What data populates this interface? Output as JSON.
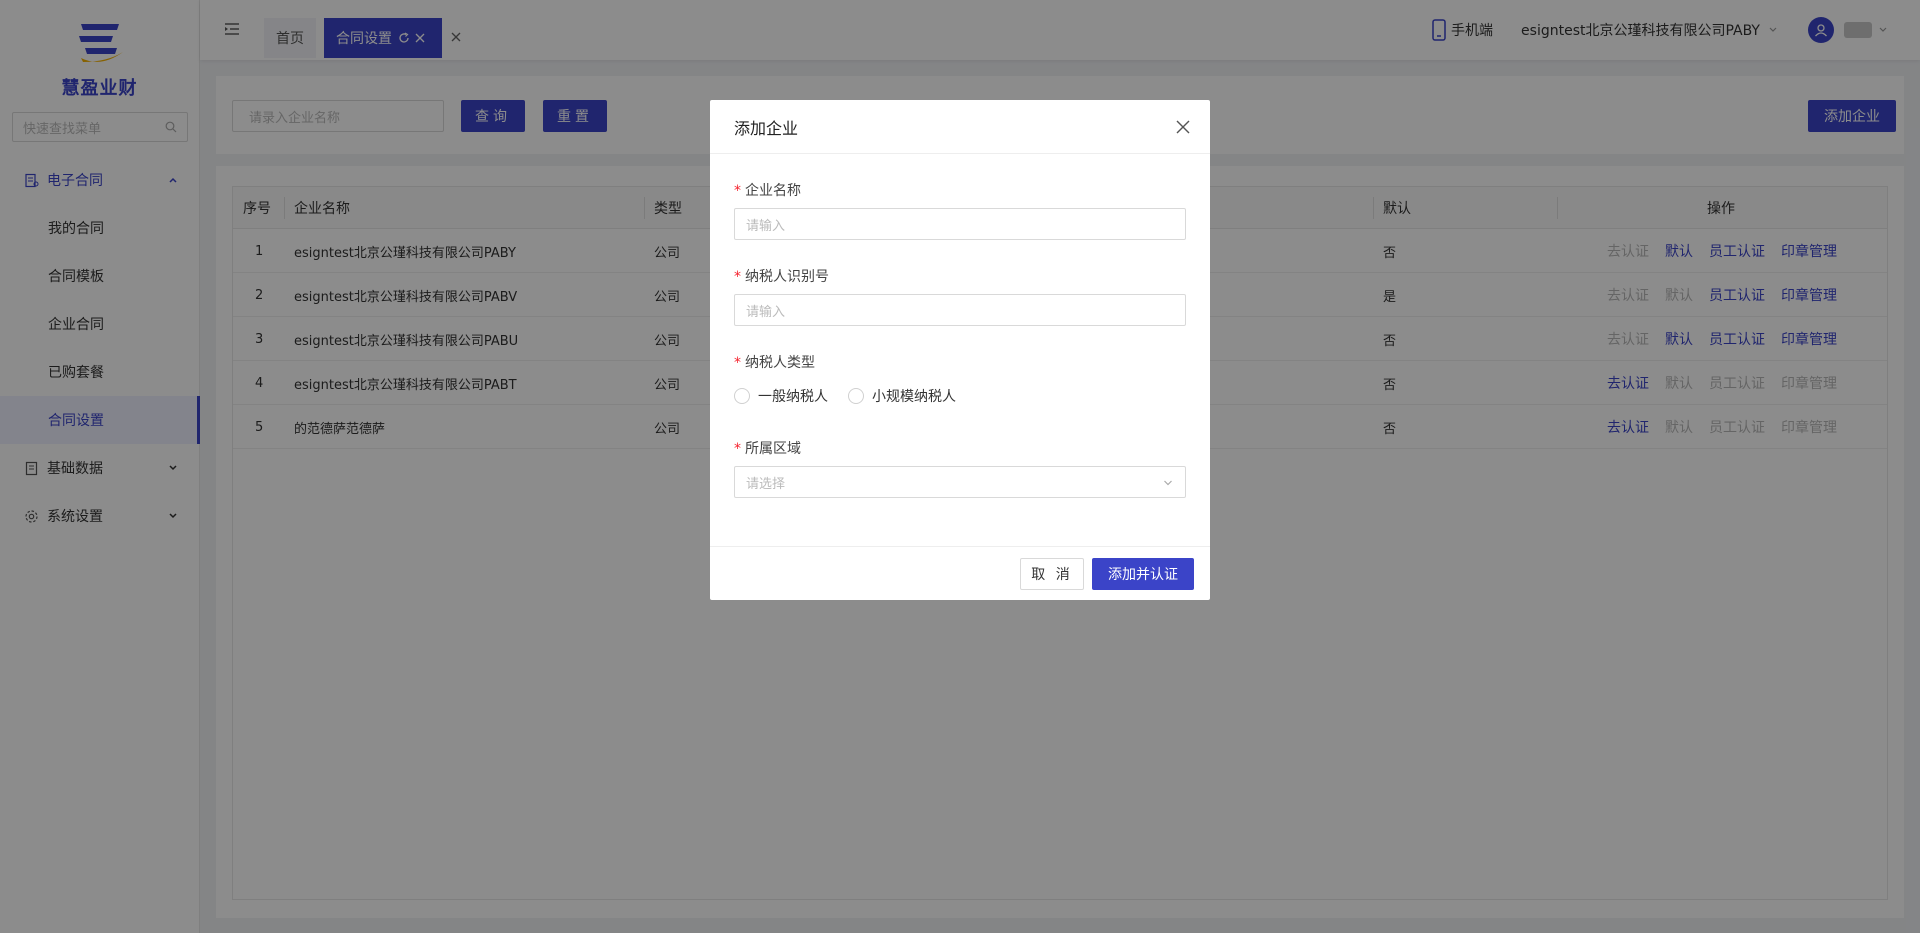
{
  "sidebar": {
    "brand": "慧盈业财",
    "search_placeholder": "快速查找菜单",
    "groups": [
      {
        "label": "电子合同",
        "items": [
          "我的合同",
          "合同模板",
          "企业合同",
          "已购套餐",
          "合同设置"
        ]
      },
      {
        "label": "基础数据"
      },
      {
        "label": "系统设置"
      }
    ]
  },
  "header": {
    "tabs": [
      "首页",
      "合同设置"
    ],
    "mobile_label": "手机端",
    "company": "esigntest北京公瑾科技有限公司PABY"
  },
  "toolbar": {
    "search_placeholder": "请录入企业名称",
    "query_label": "查询",
    "reset_label": "重置",
    "add_label": "添加企业"
  },
  "table": {
    "headers": [
      "序号",
      "企业名称",
      "类型",
      "默认",
      "操作"
    ],
    "rows": [
      {
        "no": "1",
        "name": "esigntest北京公瑾科技有限公司PABY",
        "type": "公司",
        "default": "否"
      },
      {
        "no": "2",
        "name": "esigntest北京公瑾科技有限公司PABV",
        "type": "公司",
        "default": "是"
      },
      {
        "no": "3",
        "name": "esigntest北京公瑾科技有限公司PABU",
        "type": "公司",
        "default": "否"
      },
      {
        "no": "4",
        "name": "esigntest北京公瑾科技有限公司PABT",
        "type": "公司",
        "default": "否"
      },
      {
        "no": "5",
        "name": "的范德萨范德萨",
        "type": "公司",
        "default": "否"
      }
    ],
    "ops": [
      "去认证",
      "默认",
      "员工认证",
      "印章管理"
    ]
  },
  "modal": {
    "title": "添加企业",
    "fields": {
      "company_name_label": "企业名称",
      "company_name_placeholder": "请输入",
      "tax_id_label": "纳税人识别号",
      "tax_id_placeholder": "请输入",
      "taxpayer_type_label": "纳税人类型",
      "taxpayer_options": [
        "一般纳税人",
        "小规模纳税人"
      ],
      "region_label": "所属区域",
      "region_placeholder": "请选择"
    },
    "cancel_label": "取 消",
    "submit_label": "添加并认证"
  },
  "colors": {
    "primary": "#3b44c8",
    "required": "#f5222d",
    "disabled_link": "#b8b8b8"
  }
}
